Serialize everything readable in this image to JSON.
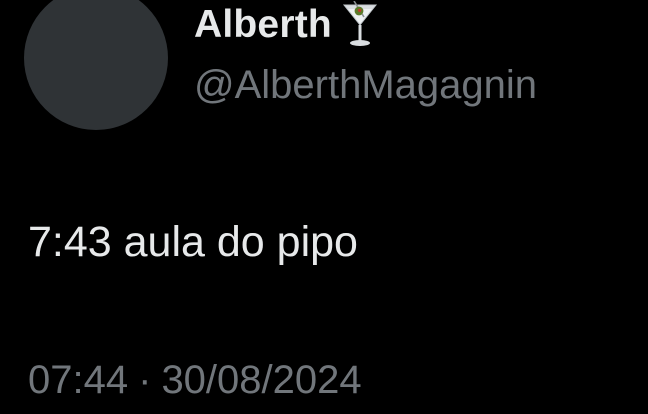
{
  "tweet": {
    "author": {
      "display_name": "Alberth",
      "emoji": "cocktail-glass-icon",
      "handle": "@AlberthMagagnin"
    },
    "text": "7:43 aula do pipo",
    "time": "07:44",
    "separator": "·",
    "date": "30/08/2024"
  },
  "colors": {
    "background": "#000000",
    "primary_text": "#e7e9ea",
    "secondary_text": "#71767b",
    "avatar_placeholder": "#2f3336"
  }
}
